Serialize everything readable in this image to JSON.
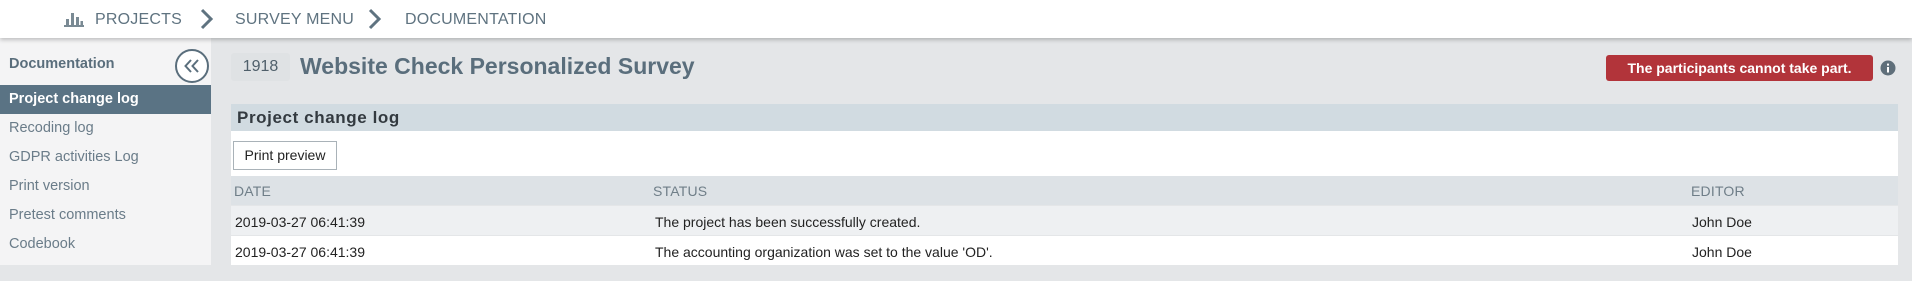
{
  "breadcrumb": {
    "icon": "bar-chart-icon",
    "items": [
      {
        "label": "PROJECTS"
      },
      {
        "label": "SURVEY MENU"
      },
      {
        "label": "DOCUMENTATION"
      }
    ]
  },
  "sidebar": {
    "title": "Documentation",
    "collapse_icon": "double-chevron-left-icon",
    "items": [
      {
        "label": "Project change log",
        "active": true
      },
      {
        "label": "Recoding log"
      },
      {
        "label": "GDPR activities Log"
      },
      {
        "label": "Print version"
      },
      {
        "label": "Pretest comments"
      },
      {
        "label": "Codebook"
      }
    ]
  },
  "header": {
    "project_id": "1918",
    "title": "Website Check Personalized Survey",
    "status_badge": "The participants cannot take part.",
    "info_icon": "info-icon"
  },
  "panel": {
    "title": "Project change log",
    "print_button": "Print preview",
    "columns": [
      "DATE",
      "STATUS",
      "EDITOR"
    ],
    "rows": [
      {
        "date": "2019-03-27 06:41:39",
        "status": "The project has been successfully created.",
        "editor": "John Doe"
      },
      {
        "date": "2019-03-27 06:41:39",
        "status": "The accounting organization was set to the value 'OD'.",
        "editor": "John Doe"
      }
    ]
  },
  "colors": {
    "accent": "#5a7384",
    "badge": "#b2343a",
    "panel_header": "#d1dbe1"
  }
}
